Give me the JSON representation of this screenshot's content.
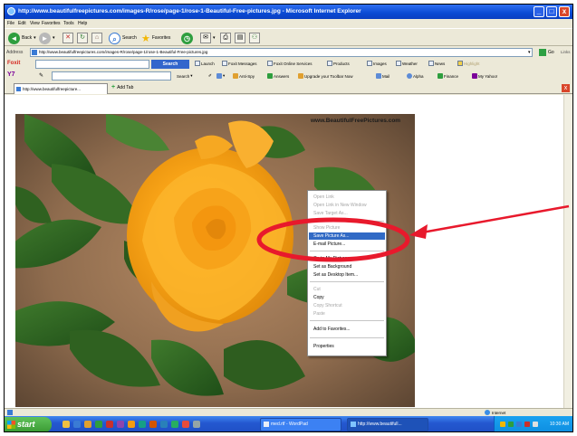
{
  "window": {
    "title": "http://www.beautifulfreepictures.com/images-R/rose/page-1/rose-1-Beautiful-Free-pictures.jpg - Microsoft Internet Explorer",
    "minimize": "_",
    "maximize": "□",
    "close": "x"
  },
  "menu": {
    "items": [
      "File",
      "Edit",
      "View",
      "Favorites",
      "Tools",
      "Help"
    ]
  },
  "toolbar": {
    "back_label": "Back",
    "search_label": "Search",
    "favorites_label": "Favorites"
  },
  "address": {
    "label": "Address",
    "value": "http://www.beautifulfreepictures.com/images-R/rose/page-1/rose-1-Beautiful-Free-pictures.jpg",
    "go_label": "Go",
    "links_label": "Links"
  },
  "foxit_toolbar": {
    "logo": "Foxit",
    "search_label": "Search",
    "items": [
      "Launch",
      "Foxit Messages",
      "Foxit Online Services",
      "Products",
      "Images",
      "Weather",
      "News",
      "Highlight"
    ]
  },
  "yahoo_toolbar": {
    "logo": "Y7",
    "search_label": "Search",
    "items": [
      "Anti-Spy",
      "Answers",
      "Upgrade your Toolbar Now",
      "Mail",
      "Alpha",
      "Finance",
      "My Yahoo!"
    ]
  },
  "tabs": {
    "active_tab_label": "http://www.beautifulfreepicture...",
    "add_tab_label": "Add Tab",
    "close": "x"
  },
  "content": {
    "watermark": "www.BeautifulFreePictures.com"
  },
  "context_menu": {
    "items": [
      {
        "label": "Open Link",
        "state": "disabled"
      },
      {
        "label": "Open Link in New Window",
        "state": "disabled"
      },
      {
        "label": "Save Target As...",
        "state": "disabled"
      },
      {
        "label": "Show Picture",
        "state": "disabled"
      },
      {
        "label": "Save Picture As...",
        "state": "highlighted"
      },
      {
        "label": "E-mail Picture...",
        "state": "enabled"
      },
      {
        "label": "Go to My Pictures",
        "state": "enabled"
      },
      {
        "label": "Set as Background",
        "state": "enabled"
      },
      {
        "label": "Set as Desktop Item...",
        "state": "enabled"
      },
      {
        "label": "Cut",
        "state": "disabled"
      },
      {
        "label": "Copy",
        "state": "enabled"
      },
      {
        "label": "Copy Shortcut",
        "state": "disabled"
      },
      {
        "label": "Paste",
        "state": "disabled"
      },
      {
        "label": "Add to Favorites...",
        "state": "enabled"
      },
      {
        "label": "Properties",
        "state": "enabled"
      }
    ]
  },
  "status": {
    "zone": "Internet"
  },
  "taskbar": {
    "start_label": "start",
    "buttons": [
      "med.rtf - WordPad",
      "http://www.beautifull..."
    ],
    "clock": "10:30 AM"
  },
  "colors": {
    "highlight": "#316ac5",
    "annotation_red": "#e8192c",
    "titlebar": "#0a4ad4"
  }
}
